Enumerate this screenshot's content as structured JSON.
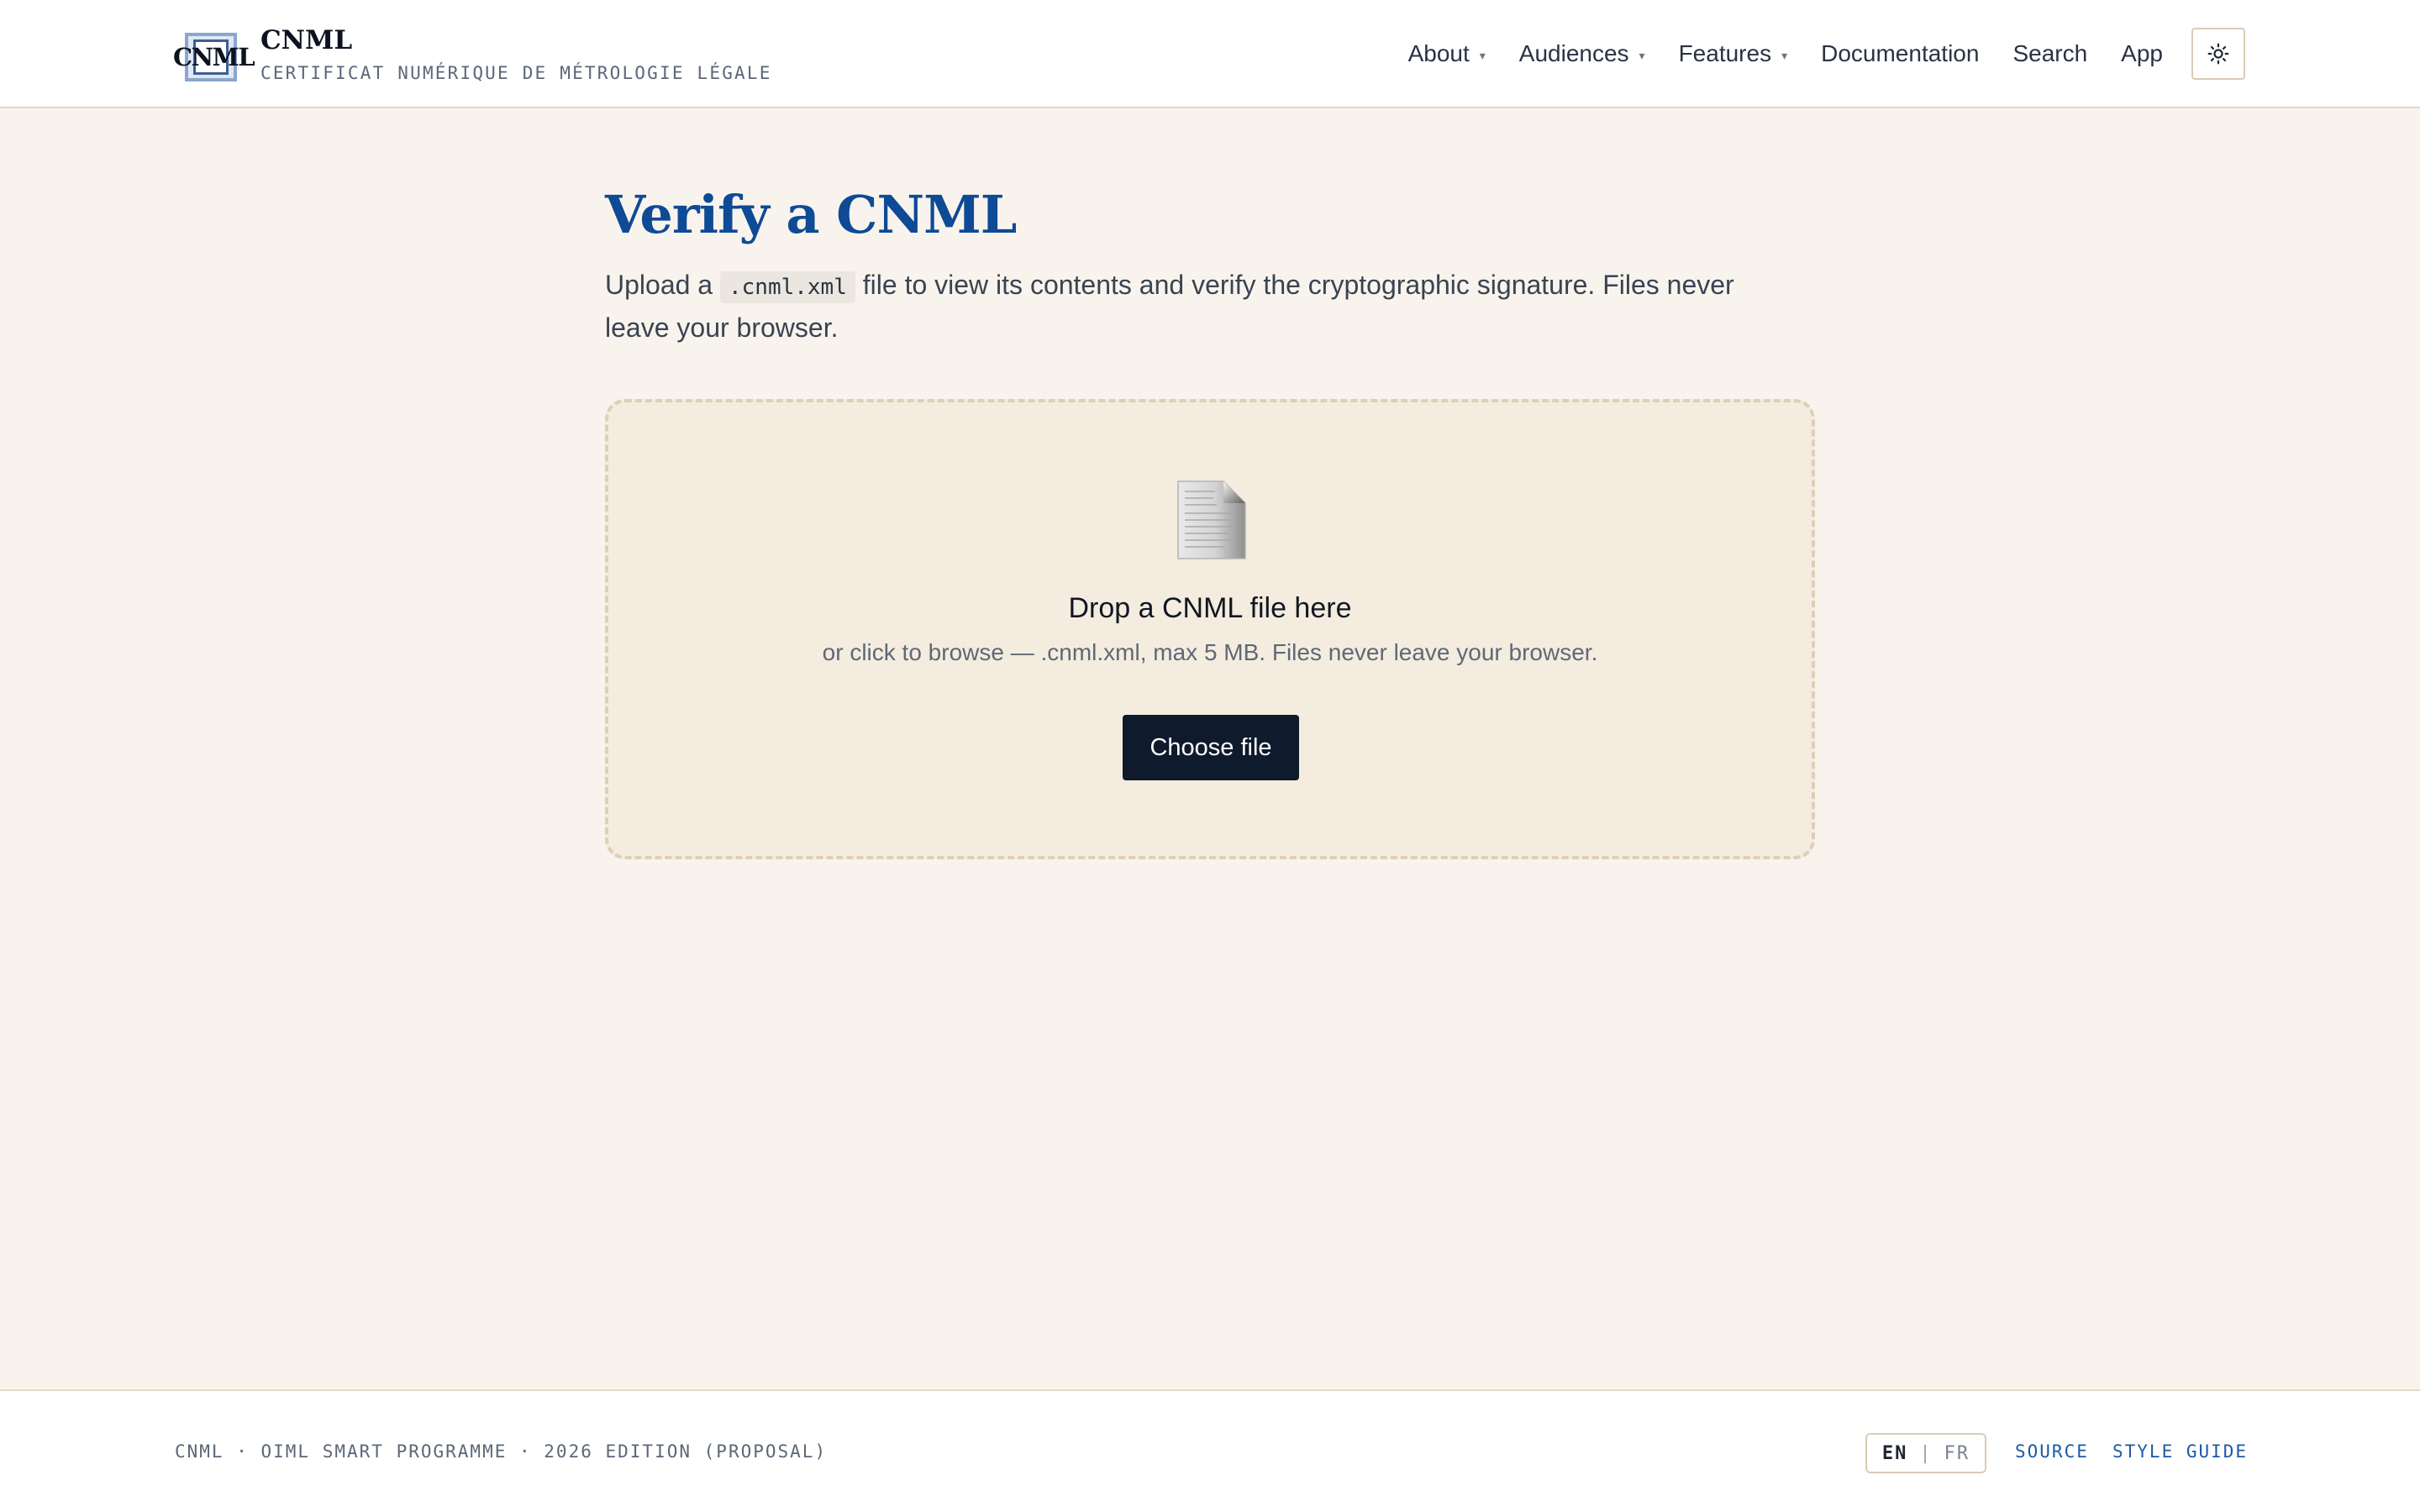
{
  "header": {
    "logo_text": "CNML",
    "brand_name": "CNML",
    "brand_tagline": "CERTIFICAT NUMÉRIQUE DE MÉTROLOGIE LÉGALE",
    "nav": [
      {
        "label": "About",
        "has_dropdown": true
      },
      {
        "label": "Audiences",
        "has_dropdown": true
      },
      {
        "label": "Features",
        "has_dropdown": true
      },
      {
        "label": "Documentation",
        "has_dropdown": false
      },
      {
        "label": "Search",
        "has_dropdown": false
      },
      {
        "label": "App",
        "has_dropdown": false
      }
    ],
    "caret_glyph": "▾",
    "theme_toggle_icon": "sun-icon"
  },
  "main": {
    "title": "Verify a CNML",
    "intro_before": "Upload a ",
    "intro_code": ".cnml.xml",
    "intro_after": " file to view its contents and verify the cryptographic signature. Files never leave your browser.",
    "dropzone": {
      "icon": "document-icon",
      "title": "Drop a CNML file here",
      "subtitle": "or click to browse — .cnml.xml, max 5 MB. Files never leave your browser.",
      "button_label": "Choose file"
    }
  },
  "footer": {
    "left_text": "CNML · OIML SMART PROGRAMME · 2026 EDITION (PROPOSAL)",
    "lang_en": "EN",
    "lang_sep": "|",
    "lang_fr": "FR",
    "source_label": "SOURCE",
    "style_guide_label": "STYLE GUIDE"
  },
  "colors": {
    "page_bg": "#f8f4ed",
    "title_blue": "#0e4a96",
    "link_blue": "#1b5aa8",
    "button_dark": "#0f1a2c",
    "dropzone_bg": "#f4ecdf",
    "dropzone_border": "#ddd0b6"
  }
}
